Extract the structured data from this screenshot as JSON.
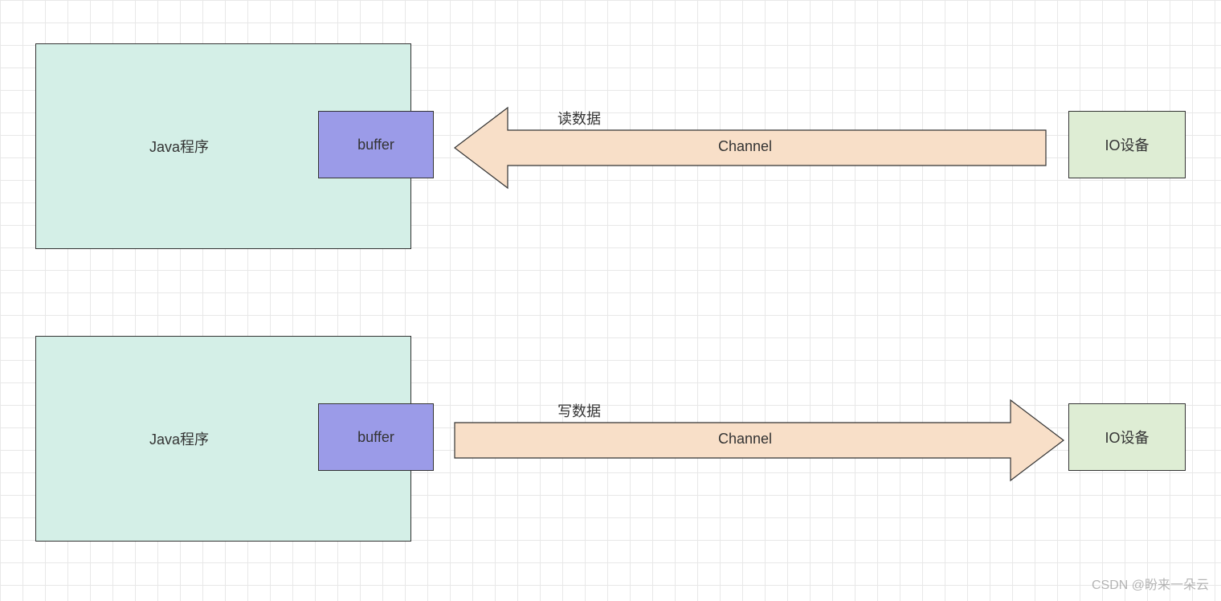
{
  "diagram": {
    "top": {
      "javaProgram": "Java程序",
      "buffer": "buffer",
      "readLabel": "读数据",
      "channel": "Channel",
      "ioDevice": "IO设备"
    },
    "bottom": {
      "javaProgram": "Java程序",
      "buffer": "buffer",
      "writeLabel": "写数据",
      "channel": "Channel",
      "ioDevice": "IO设备"
    },
    "watermark": "CSDN @盼来一朵云"
  },
  "colors": {
    "javaBox": "#d4efe7",
    "bufferBox": "#9b9be8",
    "ioBox": "#deedd4",
    "arrowFill": "#f8dfc8",
    "arrowStroke": "#333333"
  }
}
